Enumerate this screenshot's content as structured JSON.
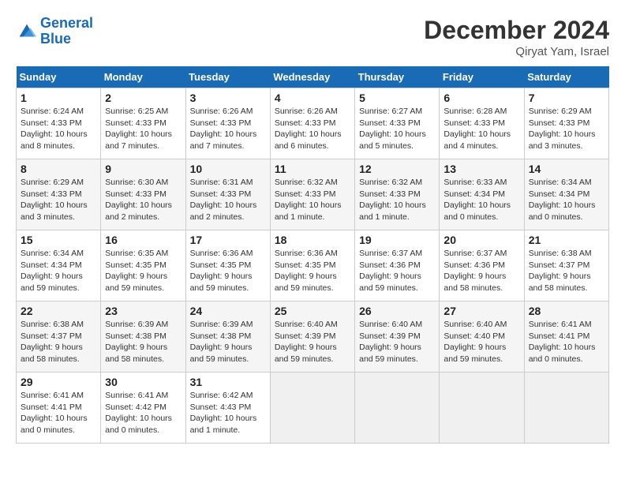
{
  "header": {
    "logo_line1": "General",
    "logo_line2": "Blue",
    "month": "December 2024",
    "location": "Qiryat Yam, Israel"
  },
  "days_of_week": [
    "Sunday",
    "Monday",
    "Tuesday",
    "Wednesday",
    "Thursday",
    "Friday",
    "Saturday"
  ],
  "weeks": [
    [
      {
        "day": "1",
        "info": "Sunrise: 6:24 AM\nSunset: 4:33 PM\nDaylight: 10 hours\nand 8 minutes."
      },
      {
        "day": "2",
        "info": "Sunrise: 6:25 AM\nSunset: 4:33 PM\nDaylight: 10 hours\nand 7 minutes."
      },
      {
        "day": "3",
        "info": "Sunrise: 6:26 AM\nSunset: 4:33 PM\nDaylight: 10 hours\nand 7 minutes."
      },
      {
        "day": "4",
        "info": "Sunrise: 6:26 AM\nSunset: 4:33 PM\nDaylight: 10 hours\nand 6 minutes."
      },
      {
        "day": "5",
        "info": "Sunrise: 6:27 AM\nSunset: 4:33 PM\nDaylight: 10 hours\nand 5 minutes."
      },
      {
        "day": "6",
        "info": "Sunrise: 6:28 AM\nSunset: 4:33 PM\nDaylight: 10 hours\nand 4 minutes."
      },
      {
        "day": "7",
        "info": "Sunrise: 6:29 AM\nSunset: 4:33 PM\nDaylight: 10 hours\nand 3 minutes."
      }
    ],
    [
      {
        "day": "8",
        "info": "Sunrise: 6:29 AM\nSunset: 4:33 PM\nDaylight: 10 hours\nand 3 minutes."
      },
      {
        "day": "9",
        "info": "Sunrise: 6:30 AM\nSunset: 4:33 PM\nDaylight: 10 hours\nand 2 minutes."
      },
      {
        "day": "10",
        "info": "Sunrise: 6:31 AM\nSunset: 4:33 PM\nDaylight: 10 hours\nand 2 minutes."
      },
      {
        "day": "11",
        "info": "Sunrise: 6:32 AM\nSunset: 4:33 PM\nDaylight: 10 hours\nand 1 minute."
      },
      {
        "day": "12",
        "info": "Sunrise: 6:32 AM\nSunset: 4:33 PM\nDaylight: 10 hours\nand 1 minute."
      },
      {
        "day": "13",
        "info": "Sunrise: 6:33 AM\nSunset: 4:34 PM\nDaylight: 10 hours\nand 0 minutes."
      },
      {
        "day": "14",
        "info": "Sunrise: 6:34 AM\nSunset: 4:34 PM\nDaylight: 10 hours\nand 0 minutes."
      }
    ],
    [
      {
        "day": "15",
        "info": "Sunrise: 6:34 AM\nSunset: 4:34 PM\nDaylight: 9 hours\nand 59 minutes."
      },
      {
        "day": "16",
        "info": "Sunrise: 6:35 AM\nSunset: 4:35 PM\nDaylight: 9 hours\nand 59 minutes."
      },
      {
        "day": "17",
        "info": "Sunrise: 6:36 AM\nSunset: 4:35 PM\nDaylight: 9 hours\nand 59 minutes."
      },
      {
        "day": "18",
        "info": "Sunrise: 6:36 AM\nSunset: 4:35 PM\nDaylight: 9 hours\nand 59 minutes."
      },
      {
        "day": "19",
        "info": "Sunrise: 6:37 AM\nSunset: 4:36 PM\nDaylight: 9 hours\nand 59 minutes."
      },
      {
        "day": "20",
        "info": "Sunrise: 6:37 AM\nSunset: 4:36 PM\nDaylight: 9 hours\nand 58 minutes."
      },
      {
        "day": "21",
        "info": "Sunrise: 6:38 AM\nSunset: 4:37 PM\nDaylight: 9 hours\nand 58 minutes."
      }
    ],
    [
      {
        "day": "22",
        "info": "Sunrise: 6:38 AM\nSunset: 4:37 PM\nDaylight: 9 hours\nand 58 minutes."
      },
      {
        "day": "23",
        "info": "Sunrise: 6:39 AM\nSunset: 4:38 PM\nDaylight: 9 hours\nand 58 minutes."
      },
      {
        "day": "24",
        "info": "Sunrise: 6:39 AM\nSunset: 4:38 PM\nDaylight: 9 hours\nand 59 minutes."
      },
      {
        "day": "25",
        "info": "Sunrise: 6:40 AM\nSunset: 4:39 PM\nDaylight: 9 hours\nand 59 minutes."
      },
      {
        "day": "26",
        "info": "Sunrise: 6:40 AM\nSunset: 4:39 PM\nDaylight: 9 hours\nand 59 minutes."
      },
      {
        "day": "27",
        "info": "Sunrise: 6:40 AM\nSunset: 4:40 PM\nDaylight: 9 hours\nand 59 minutes."
      },
      {
        "day": "28",
        "info": "Sunrise: 6:41 AM\nSunset: 4:41 PM\nDaylight: 10 hours\nand 0 minutes."
      }
    ],
    [
      {
        "day": "29",
        "info": "Sunrise: 6:41 AM\nSunset: 4:41 PM\nDaylight: 10 hours\nand 0 minutes."
      },
      {
        "day": "30",
        "info": "Sunrise: 6:41 AM\nSunset: 4:42 PM\nDaylight: 10 hours\nand 0 minutes."
      },
      {
        "day": "31",
        "info": "Sunrise: 6:42 AM\nSunset: 4:43 PM\nDaylight: 10 hours\nand 1 minute."
      },
      {
        "day": "",
        "info": ""
      },
      {
        "day": "",
        "info": ""
      },
      {
        "day": "",
        "info": ""
      },
      {
        "day": "",
        "info": ""
      }
    ]
  ]
}
